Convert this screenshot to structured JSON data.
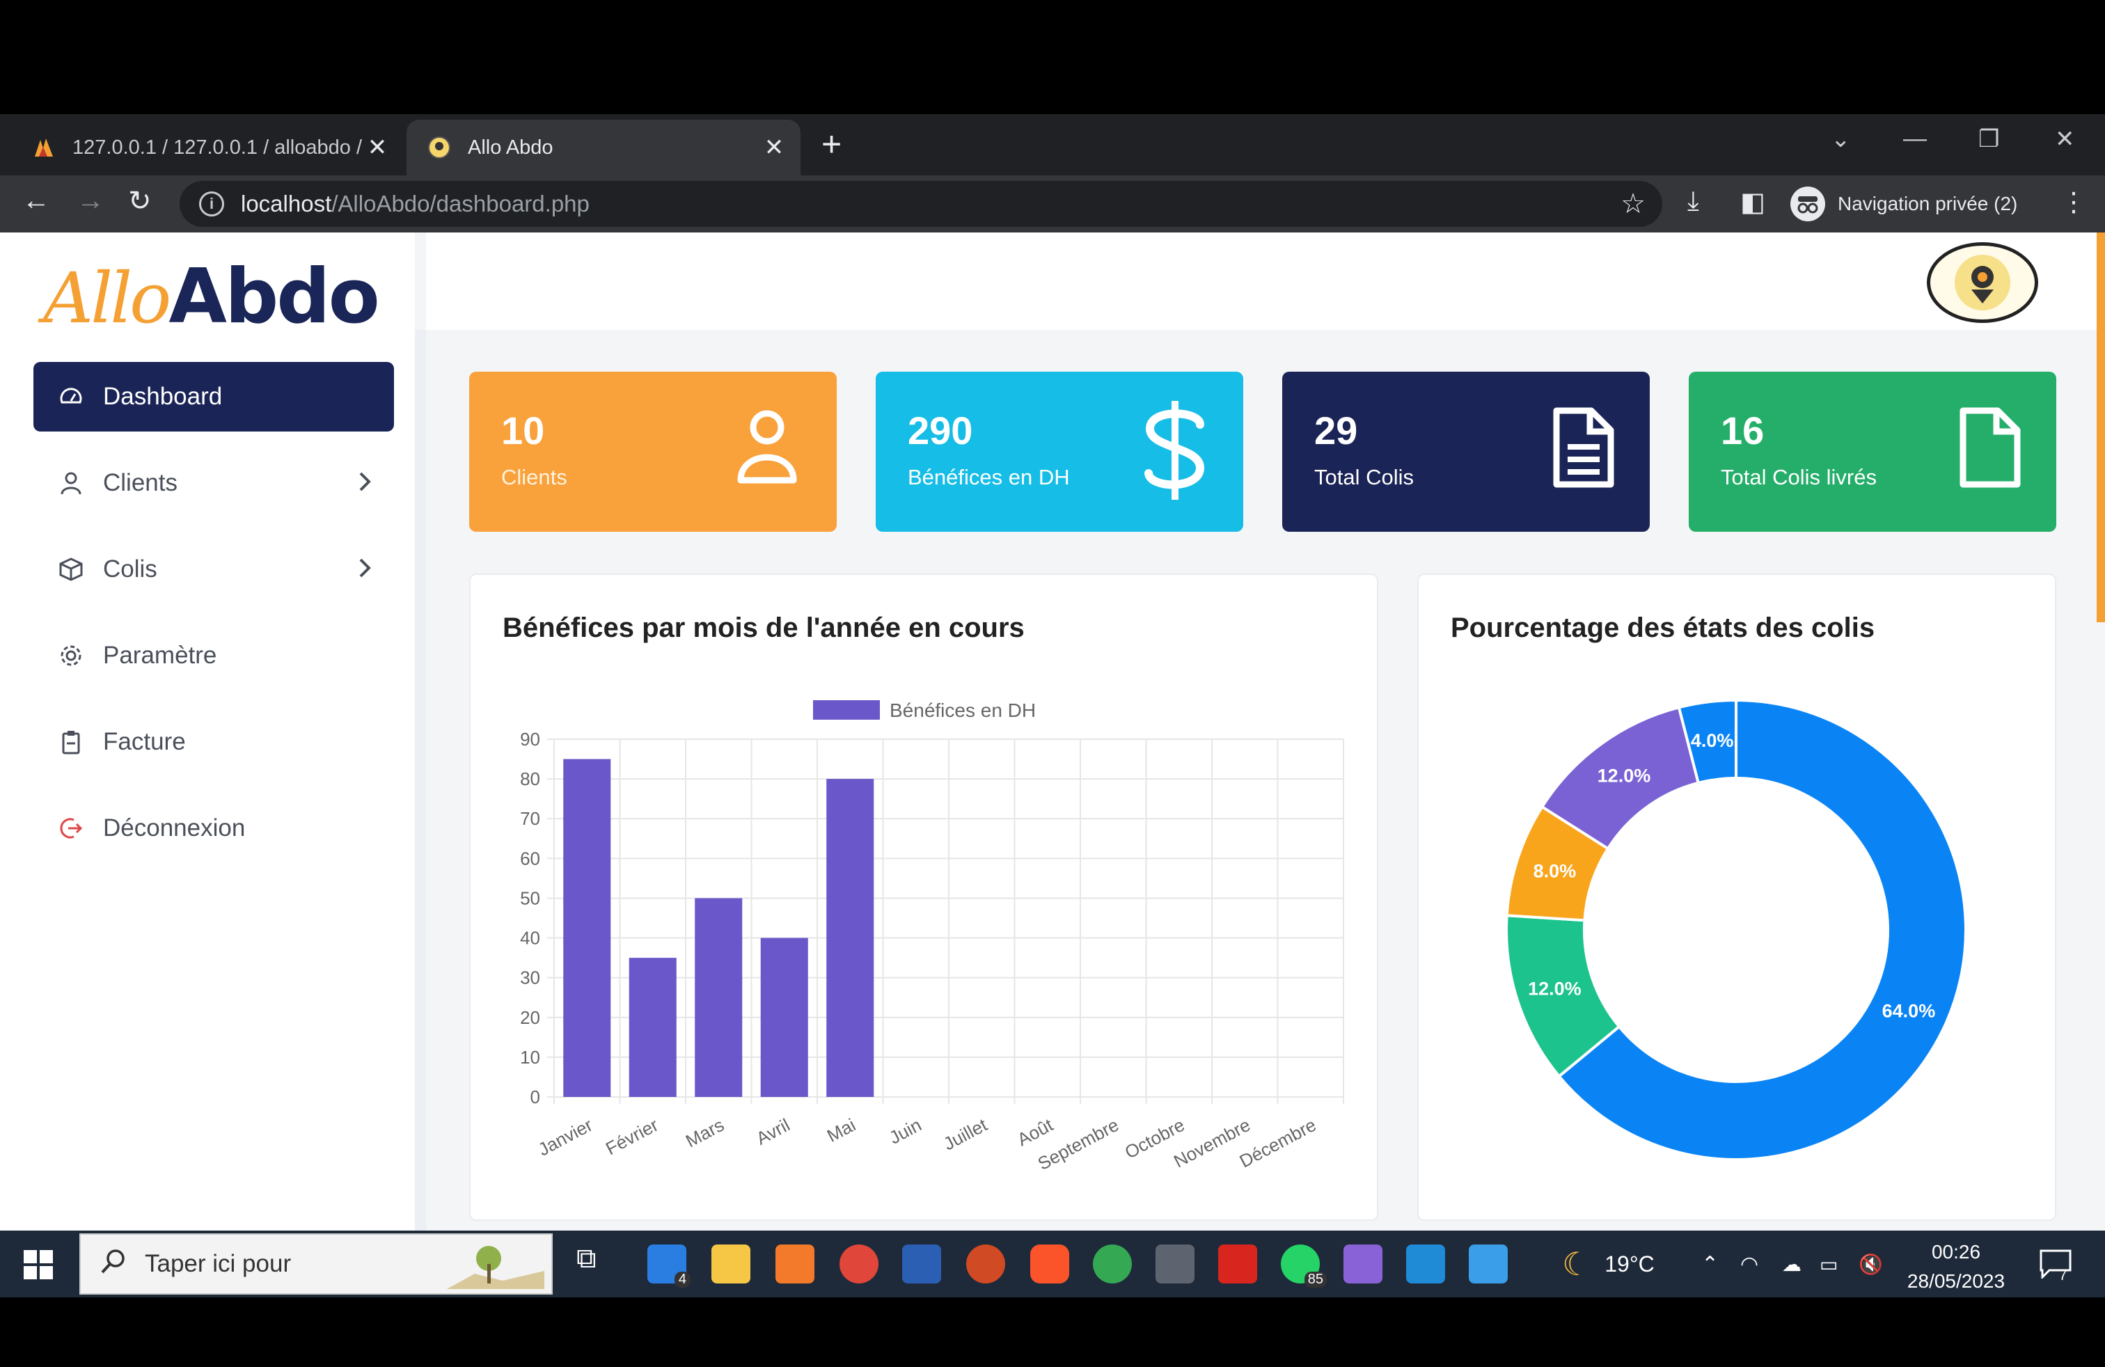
{
  "browser": {
    "tabs": [
      {
        "title": "127.0.0.1 / 127.0.0.1 / alloabdo / ",
        "icon": "phpmyadmin-icon"
      },
      {
        "title": "Allo Abdo",
        "icon": "site-favicon"
      }
    ],
    "url_host": "localhost",
    "url_path": "/AlloAbdo/dashboard.php",
    "private_label": "Navigation privée (2)"
  },
  "logo": {
    "part1": "Allo",
    "part2": "Abdo"
  },
  "sidebar": {
    "items": [
      {
        "label": "Dashboard",
        "icon": "gauge-icon",
        "active": true
      },
      {
        "label": "Clients",
        "icon": "user-icon",
        "has_submenu": true
      },
      {
        "label": "Colis",
        "icon": "box-icon",
        "has_submenu": true
      },
      {
        "label": "Paramètre",
        "icon": "gear-icon"
      },
      {
        "label": "Facture",
        "icon": "clipboard-icon"
      },
      {
        "label": "Déconnexion",
        "icon": "logout-icon"
      }
    ]
  },
  "cards": [
    {
      "value": "10",
      "label": "Clients",
      "icon": "user-icon",
      "color": "#f9a13a"
    },
    {
      "value": "290",
      "label": "Bénéfices en DH",
      "icon": "dollar-icon",
      "color": "#16bde6"
    },
    {
      "value": "29",
      "label": "Total Colis",
      "icon": "document-icon",
      "color": "#1b2456"
    },
    {
      "value": "16",
      "label": "Total Colis livrés",
      "icon": "file-icon",
      "color": "#25ae6a"
    }
  ],
  "bar_panel": {
    "title": "Bénéfices par mois de l'année en cours"
  },
  "pie_panel": {
    "title": "Pourcentage des états des colis"
  },
  "chart_data": [
    {
      "type": "bar",
      "title": "",
      "legend_position": "top",
      "categories": [
        "Janvier",
        "Février",
        "Mars",
        "Avril",
        "Mai",
        "Juin",
        "Juillet",
        "Août",
        "Septembre",
        "Octobre",
        "Novembre",
        "Décembre"
      ],
      "series": [
        {
          "name": "Bénéfices en DH",
          "color": "#6a57c9",
          "values": [
            85,
            35,
            50,
            40,
            80,
            0,
            0,
            0,
            0,
            0,
            0,
            0
          ]
        }
      ],
      "yticks": [
        0,
        10,
        20,
        30,
        40,
        50,
        60,
        70,
        80,
        90
      ],
      "ylim": [
        0,
        90
      ],
      "grid": true
    },
    {
      "type": "pie",
      "style": "doughnut",
      "slices": [
        {
          "value": 64.0,
          "label": "64.0%",
          "color": "#0a84f5"
        },
        {
          "value": 12.0,
          "label": "12.0%",
          "color": "#1dc38c"
        },
        {
          "value": 8.0,
          "label": "8.0%",
          "color": "#f8a51c"
        },
        {
          "value": 12.0,
          "label": "12.0%",
          "color": "#7a62d4"
        },
        {
          "value": 4.0,
          "label": "4.0%",
          "color": "#0a84f5"
        }
      ]
    }
  ],
  "taskbar": {
    "search_placeholder": "Taper ici pour",
    "mail_badge": "4",
    "whatsapp_badge": "85",
    "weather": "19°C",
    "time": "00:26",
    "date": "28/05/2023",
    "notif_count": "7"
  }
}
